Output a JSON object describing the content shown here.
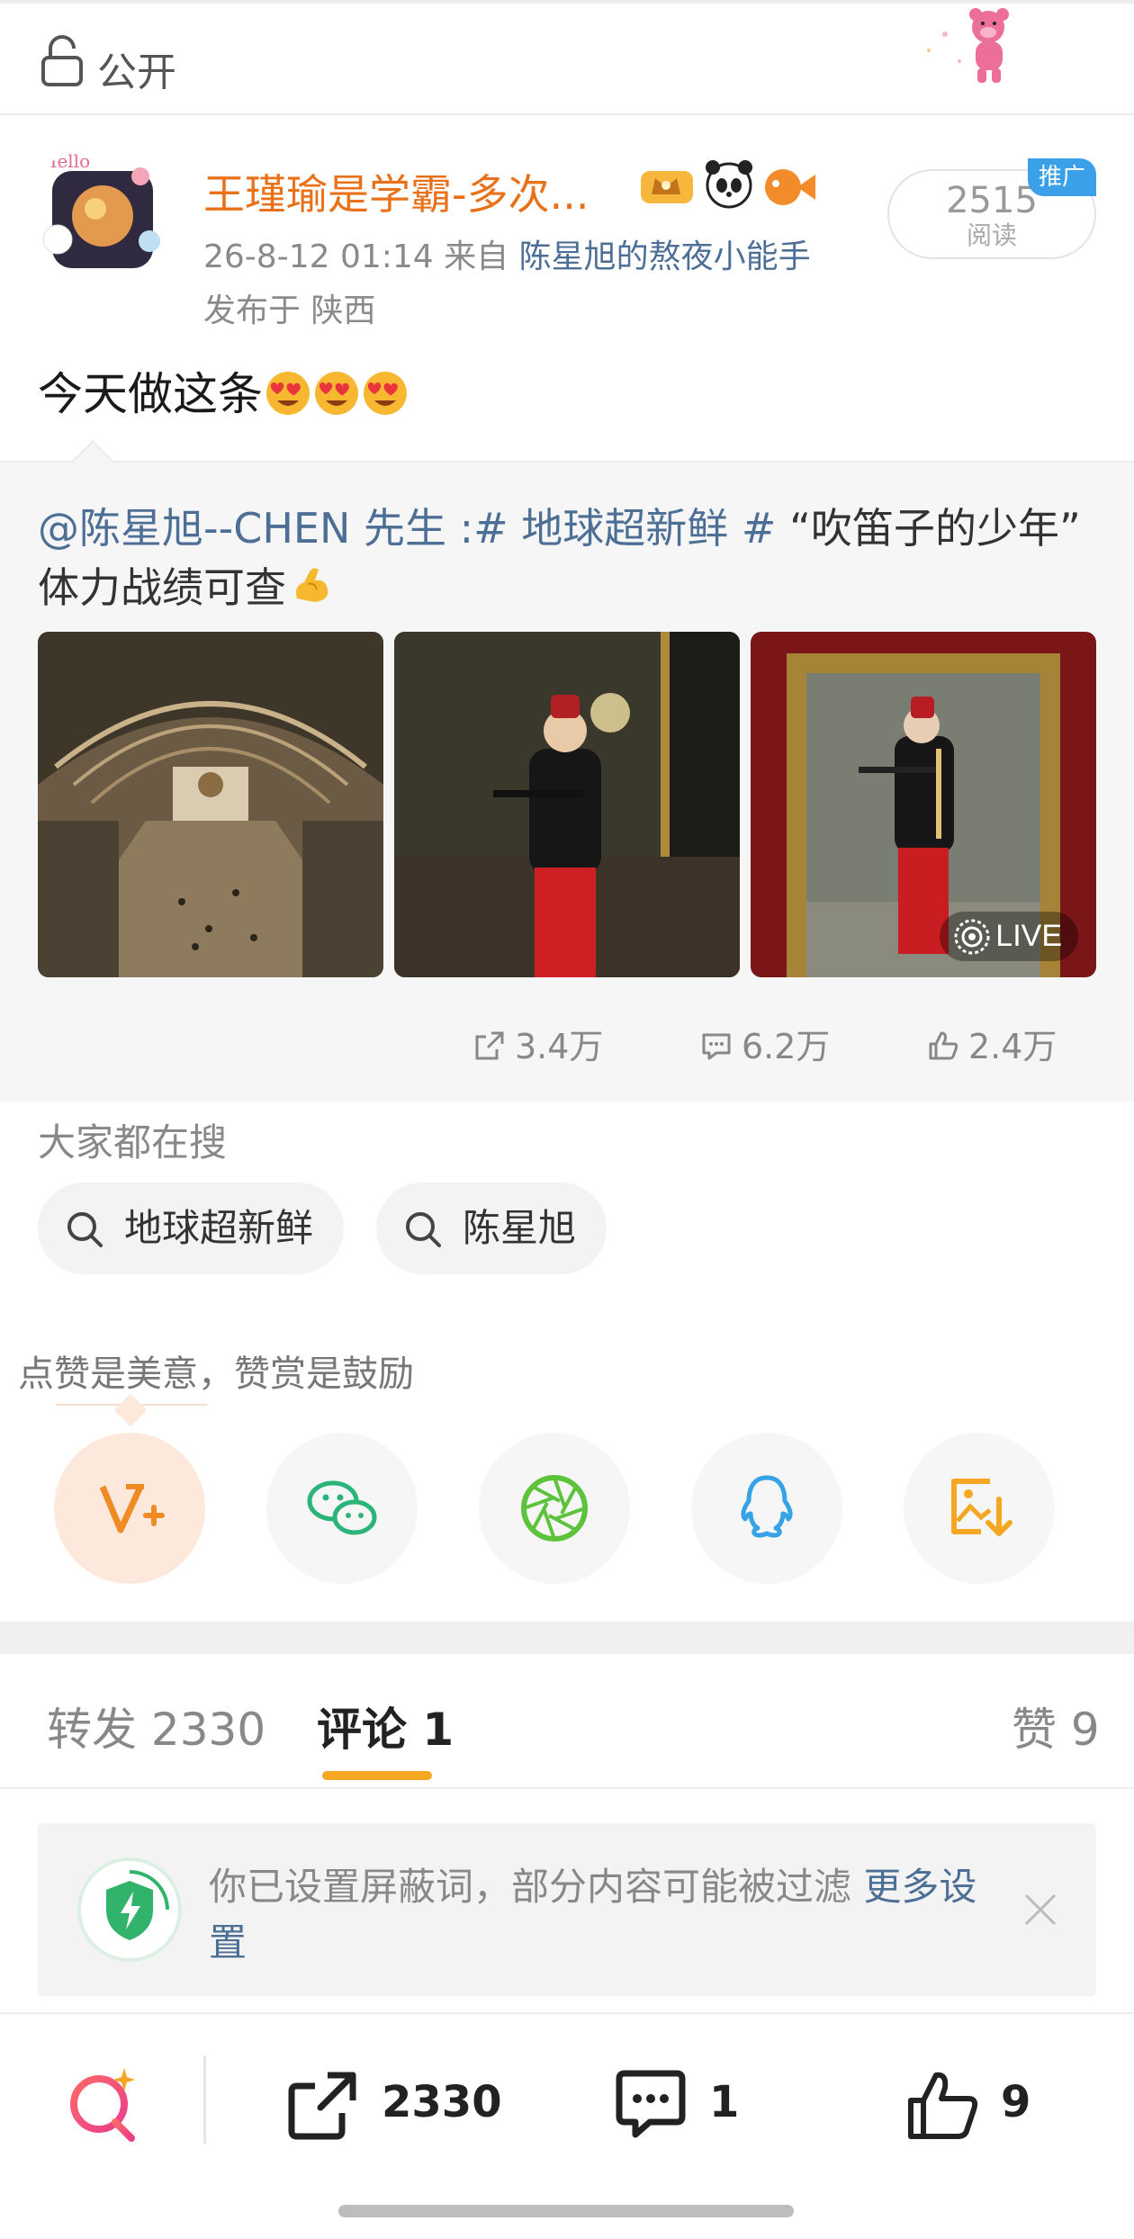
{
  "topbar": {
    "visibility_label": "公开",
    "lock_icon": "lock-open-icon",
    "sticker": "pink-bear-sticker"
  },
  "author": {
    "name": "王瑾瑜是学霸-多次...",
    "badges": [
      "crown-badge-icon",
      "panda-badge-icon",
      "fish-badge-icon"
    ],
    "time": "26-8-12 01:14",
    "from_prefix": "来自",
    "from_source": "陈星旭的熬夜小能手",
    "location": "发布于 陕西",
    "reads_count": "2515",
    "reads_label": "阅读",
    "promo_tag": "推广"
  },
  "post": {
    "text": "今天做这条",
    "emojis": [
      "heart-eyes-emoji",
      "heart-eyes-emoji",
      "heart-eyes-emoji"
    ]
  },
  "repost": {
    "mention": "@陈星旭--CHEN 先生",
    "colon": " :",
    "hashtag": "# 地球超新鲜 #",
    "quote": " “吹笛子的少年”",
    "line2": "体力战绩可查",
    "line2_emoji": "flexed-biceps-emoji",
    "images": [
      {
        "name": "museum-hall-photo"
      },
      {
        "name": "flute-boy-photo"
      },
      {
        "name": "flute-painting-photo",
        "badge": "LIVE"
      }
    ],
    "stats": {
      "shares": "3.4万",
      "comments": "6.2万",
      "likes": "2.4万"
    }
  },
  "searches": {
    "title": "大家都在搜",
    "chips": [
      "地球超新鲜",
      "陈星旭"
    ]
  },
  "share": {
    "tip": "点赞是美意，赞赏是鼓励",
    "icons": [
      "reward-v-plus-icon",
      "wechat-icon",
      "moments-icon",
      "qq-icon",
      "save-image-icon"
    ]
  },
  "tabs": {
    "repost_label": "转发 2330",
    "comment_label": "评论 1",
    "like_label": "赞 9",
    "active": "comment"
  },
  "notice": {
    "text": "你已设置屏蔽词，部分内容可能被过滤 ",
    "more": "更多设置"
  },
  "bottom": {
    "repost_count": "2330",
    "comment_count": "1",
    "like_count": "9"
  },
  "colors": {
    "name_orange": "#e8711a",
    "link_blue": "#4d6f95",
    "accent_yellow": "#f5a623",
    "promo_blue": "#3aa0e8"
  }
}
